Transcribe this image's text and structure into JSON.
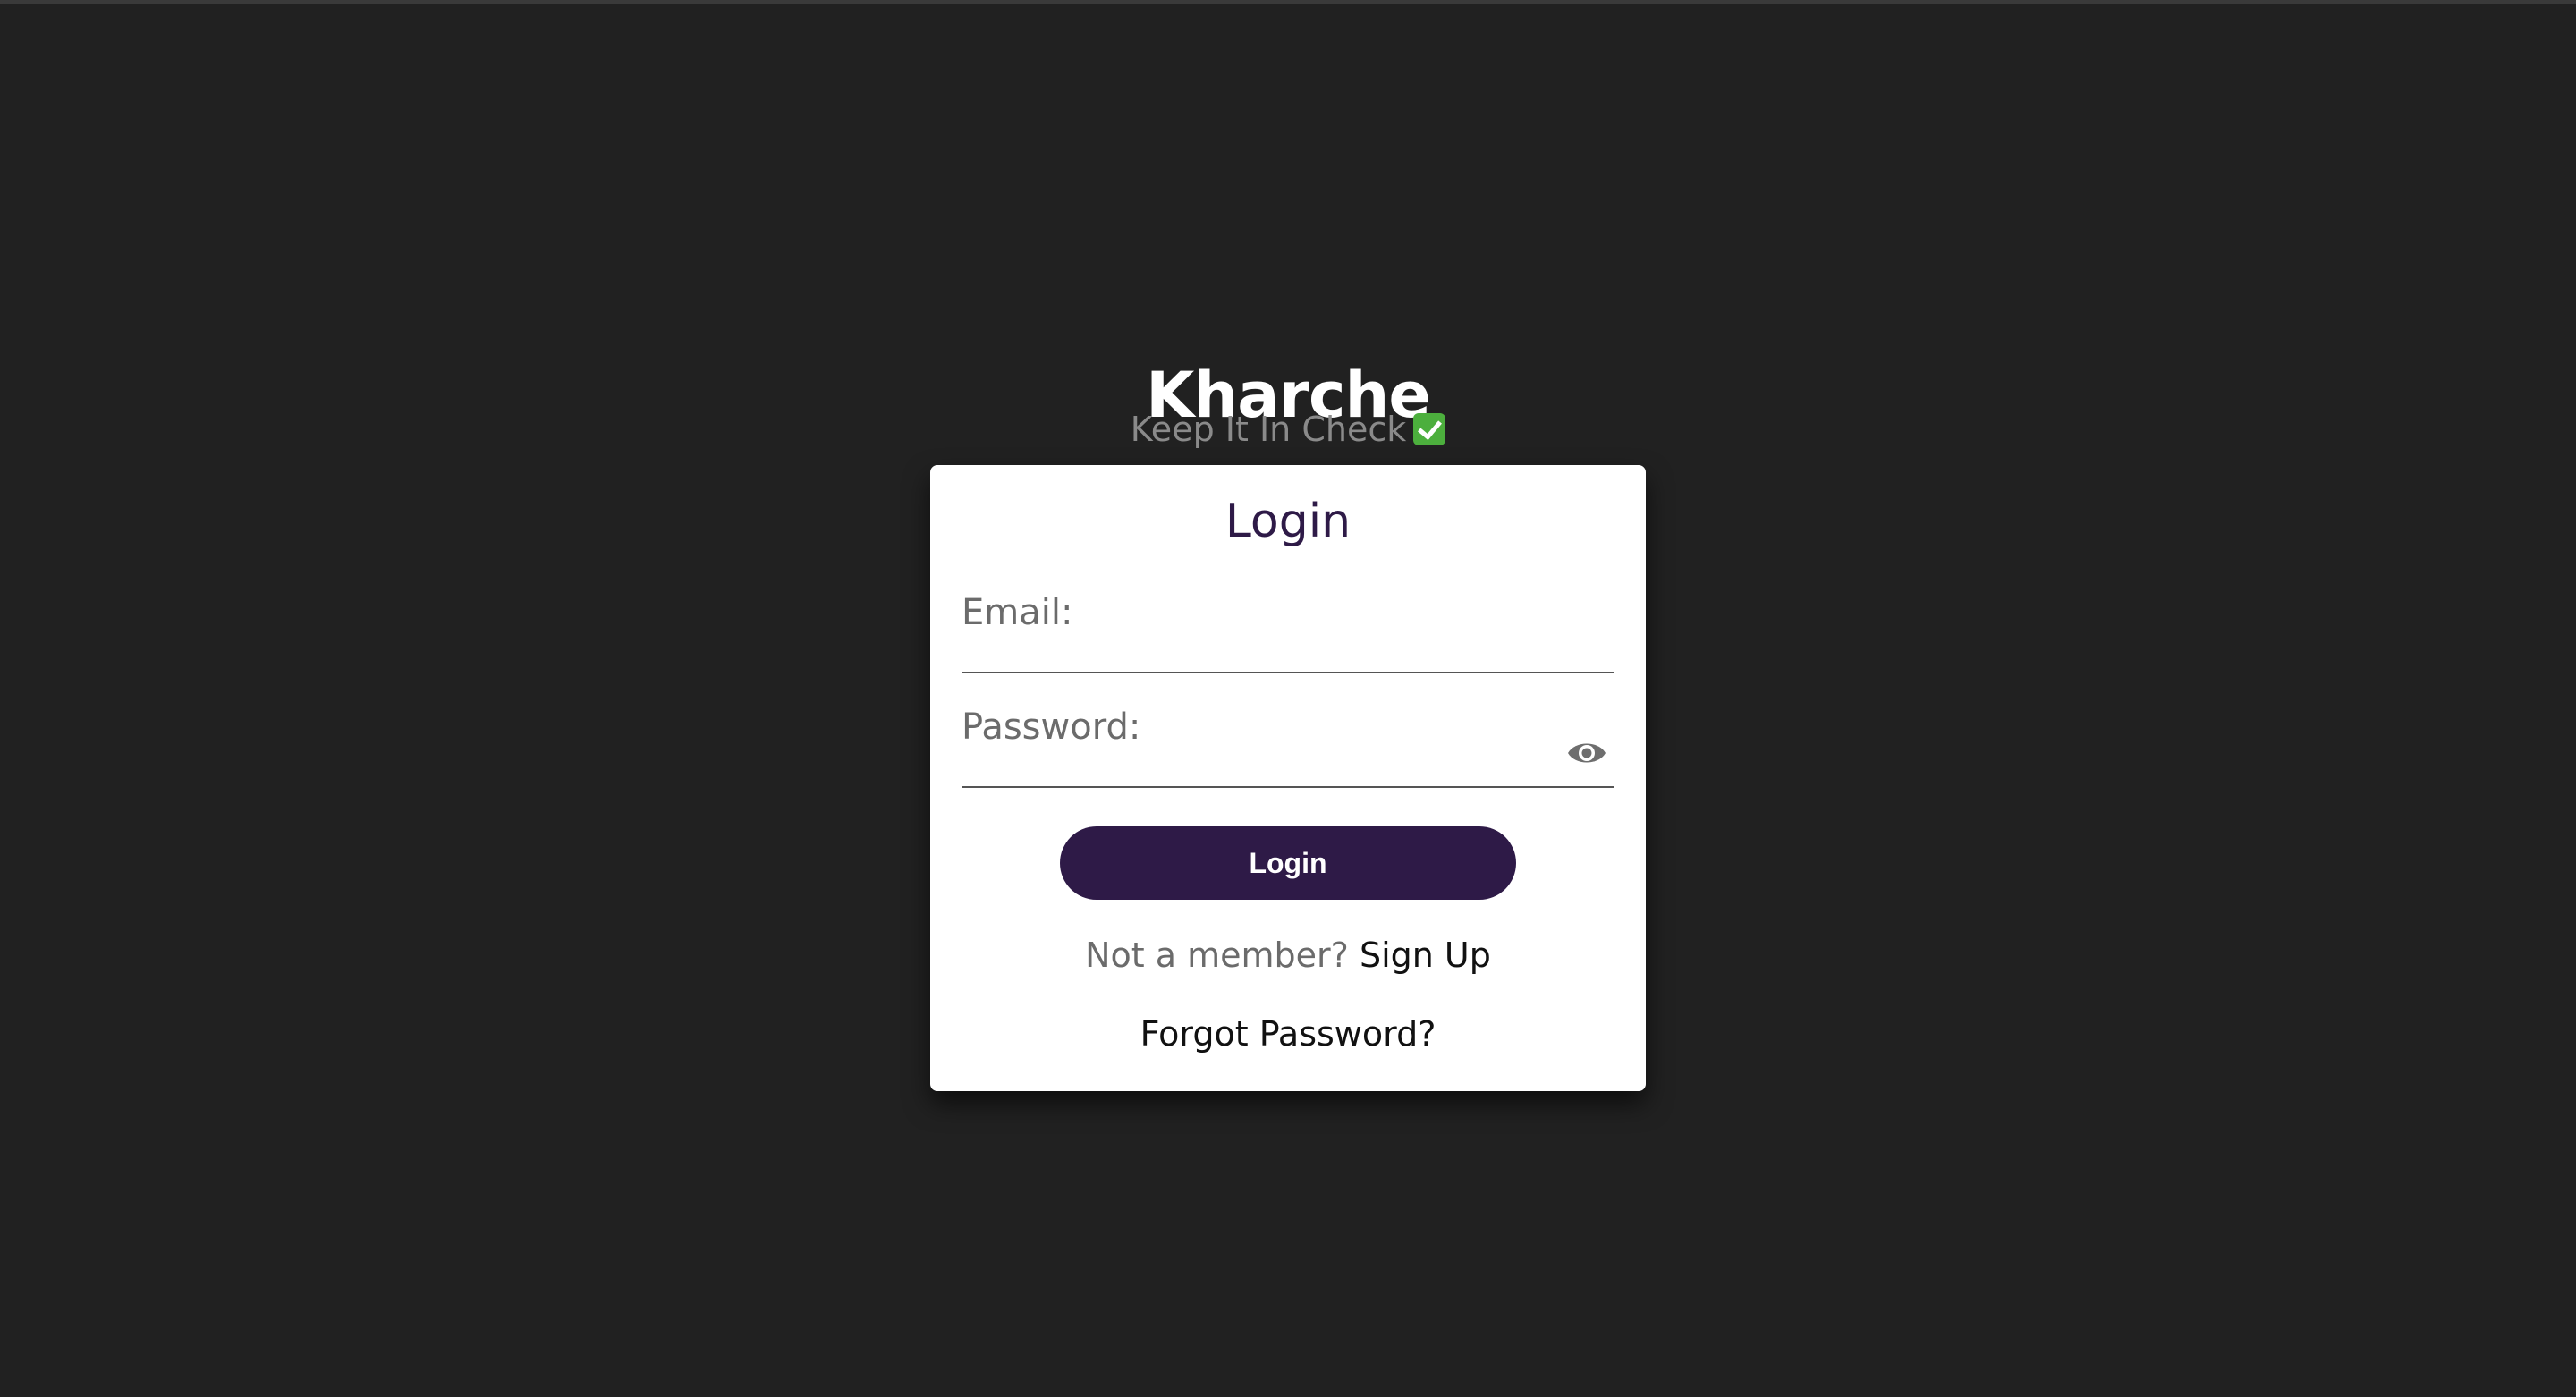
{
  "app": {
    "title": "Kharche",
    "tagline": "Keep It In Check",
    "tagline_icon": "check-mark-button-emoji"
  },
  "login_card": {
    "title": "Login",
    "email": {
      "label": "Email:",
      "value": ""
    },
    "password": {
      "label": "Password:",
      "value": "",
      "visibility_icon": "eye-icon"
    },
    "submit_label": "Login",
    "signup_prompt": "Not a member?",
    "signup_link": "Sign Up",
    "forgot_link": "Forgot Password?"
  },
  "colors": {
    "background": "#212121",
    "card": "#ffffff",
    "accent": "#2e1a47",
    "muted_text": "#6b6b6b",
    "tagline_text": "#8a8a8a",
    "check_green": "#4caf3d"
  }
}
